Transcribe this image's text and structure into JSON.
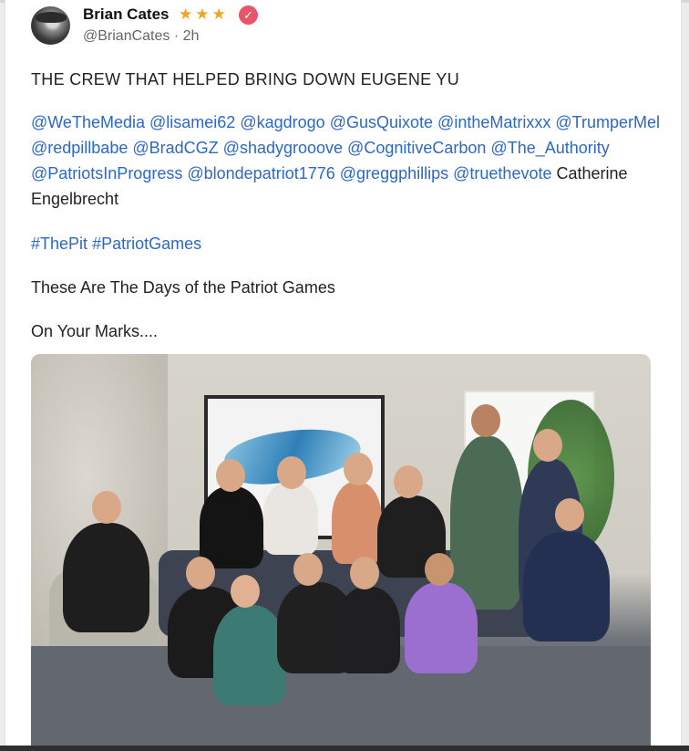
{
  "post": {
    "author_name": "Brian Cates",
    "author_stars": "★★★",
    "verified_mark": "✓",
    "handle": "@BrianCates",
    "time_sep": " · ",
    "time": "2h",
    "headline": "THE CREW THAT HELPED BRING DOWN EUGENE YU",
    "mentions": [
      "@WeTheMedia",
      "@lisamei62",
      "@kagdrogo",
      "@GusQuixote",
      "@intheMatrixxx",
      "@TrumperMel",
      "@redpillbabe",
      "@BradCGZ",
      "@shadygrooove",
      "@CognitiveCarbon",
      "@The_Authority",
      "@PatriotsInProgress",
      "@blondepatriot1776",
      "@greggphillips",
      "@truethevote"
    ],
    "mention_tail": "Catherine Engelbrecht",
    "hashtags": [
      "#ThePit",
      "#PatriotGames"
    ],
    "line_days": "These Are The Days of the Patriot Games",
    "line_marks": "On Your Marks...."
  },
  "colors": {
    "mention": "#2c68c5",
    "stars": "#f0a526",
    "verified": "#e8546a"
  },
  "icons": {
    "verified": "verified-badge-icon",
    "stars": "star-icon"
  }
}
